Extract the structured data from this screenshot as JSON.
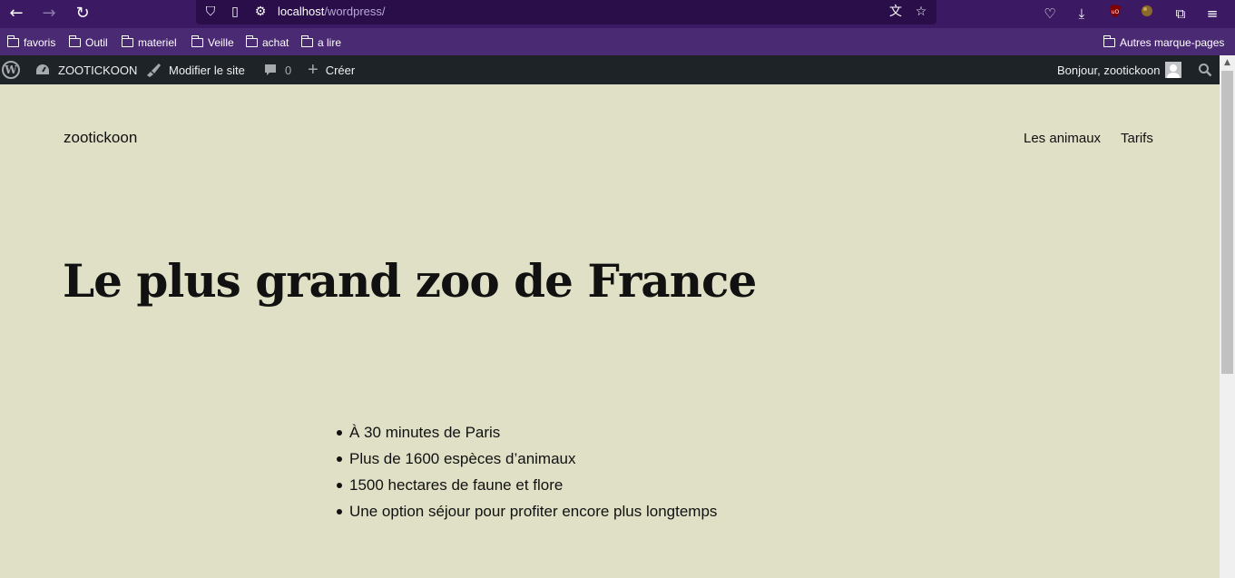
{
  "browser": {
    "url_host": "localhost",
    "url_path": "/wordpress/",
    "bookmarks": [
      "favoris",
      "Outil",
      "materiel",
      "Veille",
      "achat",
      "a lire"
    ],
    "other_bookmarks": "Autres marque-pages"
  },
  "adminbar": {
    "site_name": "ZOOTICKOON",
    "edit_site": "Modifier le site",
    "comments_count": "0",
    "new_label": "Créer",
    "greeting": "Bonjour, zootickoon"
  },
  "site": {
    "title": "zootickoon",
    "nav": [
      "Les animaux",
      "Tarifs"
    ]
  },
  "main": {
    "heading": "Le plus grand zoo de France",
    "features": [
      "À 30 minutes de Paris",
      "Plus de 1600 espèces d’animaux",
      "1500 hectares de faune et flore",
      "Une option séjour pour profiter encore plus longtemps"
    ]
  },
  "colors": {
    "page_background": "#e0e0c6",
    "adminbar": "#1d2327",
    "browser_toolbar": "#3b1a63"
  }
}
